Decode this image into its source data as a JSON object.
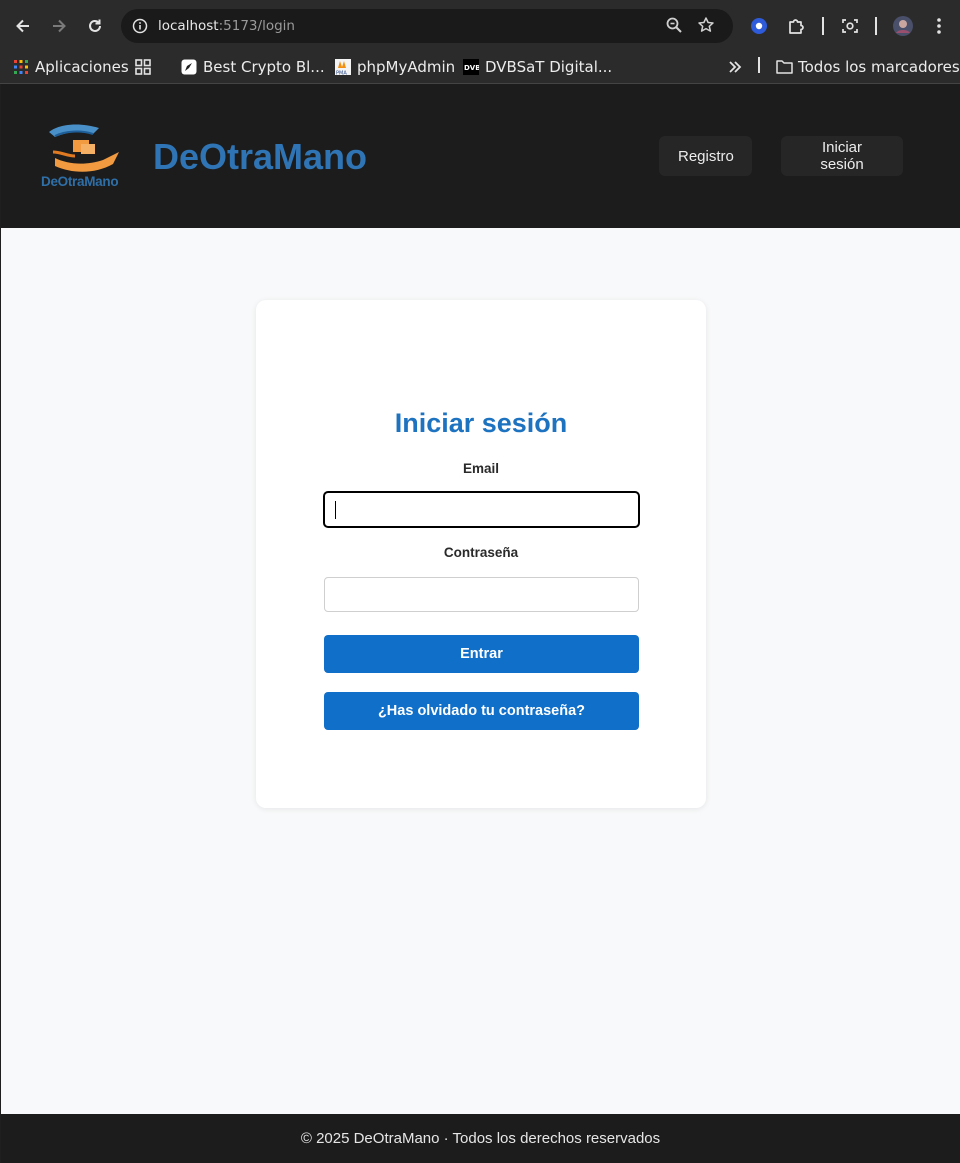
{
  "browser": {
    "url_host": "localhost",
    "url_path": ":5173/login",
    "bookmarks": [
      {
        "label": "Aplicaciones",
        "icon": "apps-grid-icon"
      },
      {
        "label": "",
        "icon": "tab-groups-icon"
      },
      {
        "label": "Best Crypto Bl...",
        "icon": "rocket-icon"
      },
      {
        "label": "phpMyAdmin",
        "icon": "pma-icon"
      },
      {
        "label": "DVBSaT Digital...",
        "icon": "dvb-icon"
      }
    ],
    "all_bookmarks_label": "Todos los marcadores"
  },
  "header": {
    "logo_text": "DeOtraMano",
    "brand": "DeOtraMano",
    "register_label": "Registro",
    "login_label": "Iniciar sesión"
  },
  "login": {
    "title": "Iniciar sesión",
    "email_label": "Email",
    "email_value": "",
    "password_label": "Contraseña",
    "password_value": "",
    "submit_label": "Entrar",
    "forgot_label": "¿Has olvidado tu contraseña?"
  },
  "footer": {
    "text": "© 2025 DeOtraMano · Todos los derechos reservados"
  },
  "colors": {
    "primary": "#0f6fc9",
    "brand_text": "#2f74b5",
    "header_bg": "#1c1c1c",
    "page_bg": "#f8f9fa"
  }
}
